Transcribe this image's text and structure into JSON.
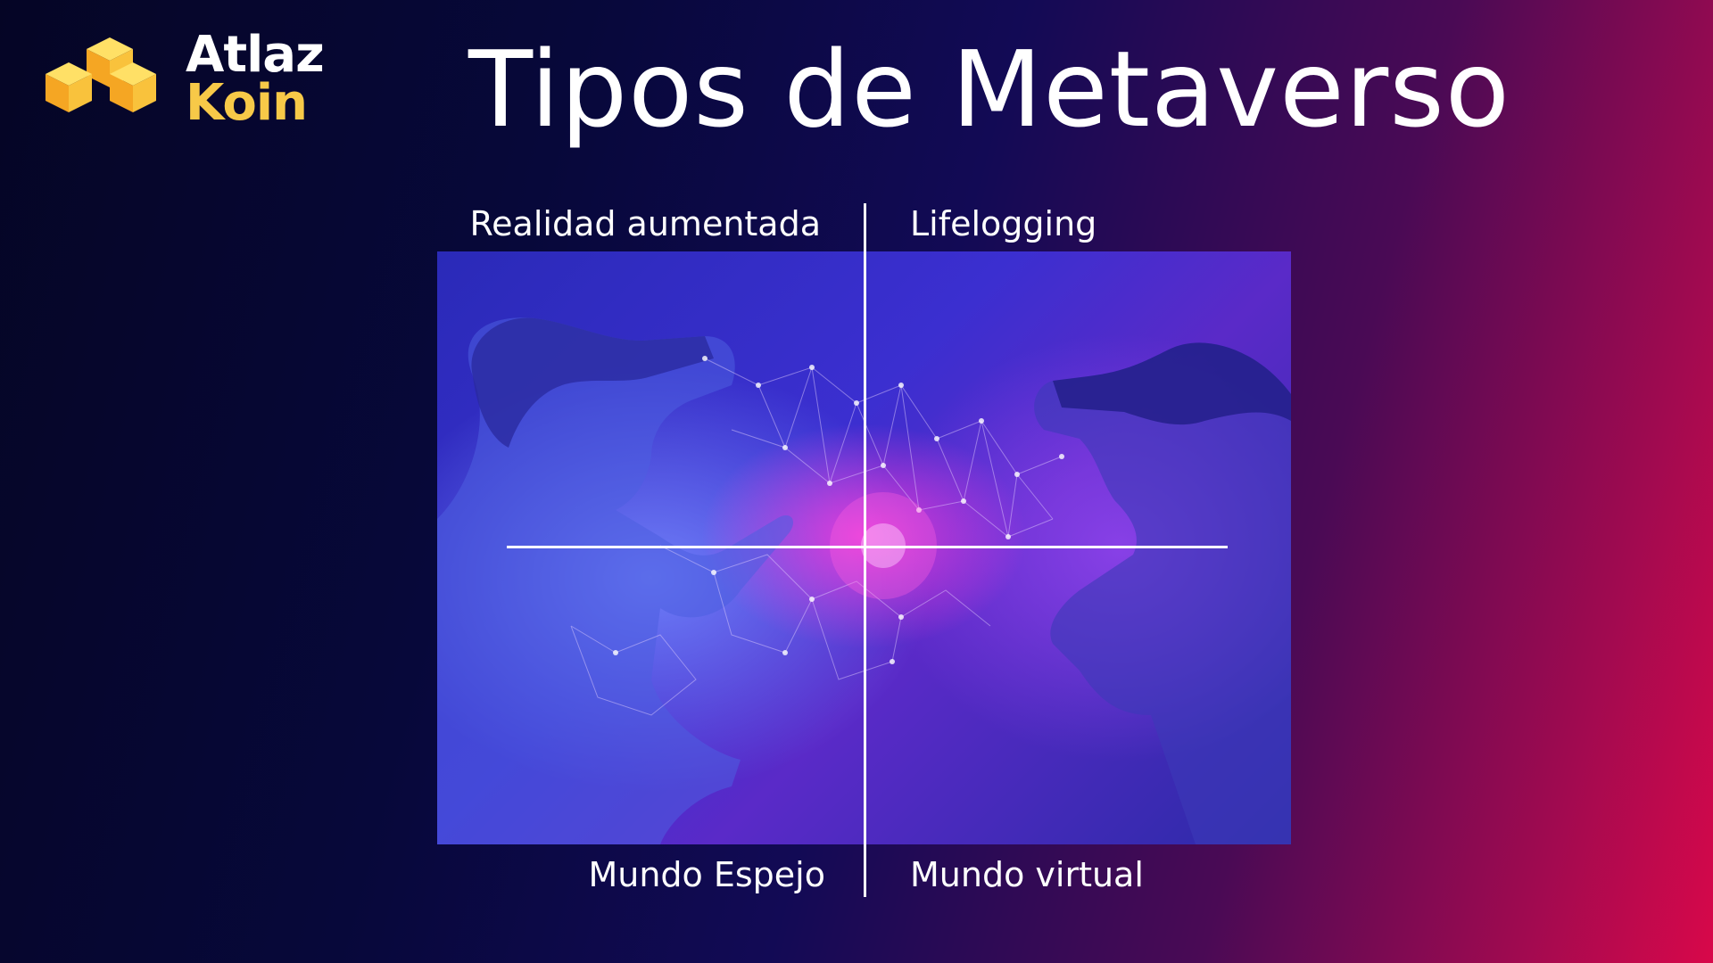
{
  "logo": {
    "line1": "Atlaz",
    "line2": "Koin",
    "icon": "stacked-cubes-icon",
    "colors": {
      "cube_top": "#ffd54a",
      "cube_left": "#f5a623",
      "cube_right": "#f7b733",
      "word2": "#f7c948"
    }
  },
  "title": "Tipos de Metaverso",
  "quadrants": {
    "top_left": "Realidad aumentada",
    "top_right": "Lifelogging",
    "bottom_left": "Mundo Espejo",
    "bottom_right": "Mundo virtual"
  },
  "colors": {
    "background_start": "#050525",
    "background_end": "#d8084a",
    "text": "#ffffff"
  }
}
